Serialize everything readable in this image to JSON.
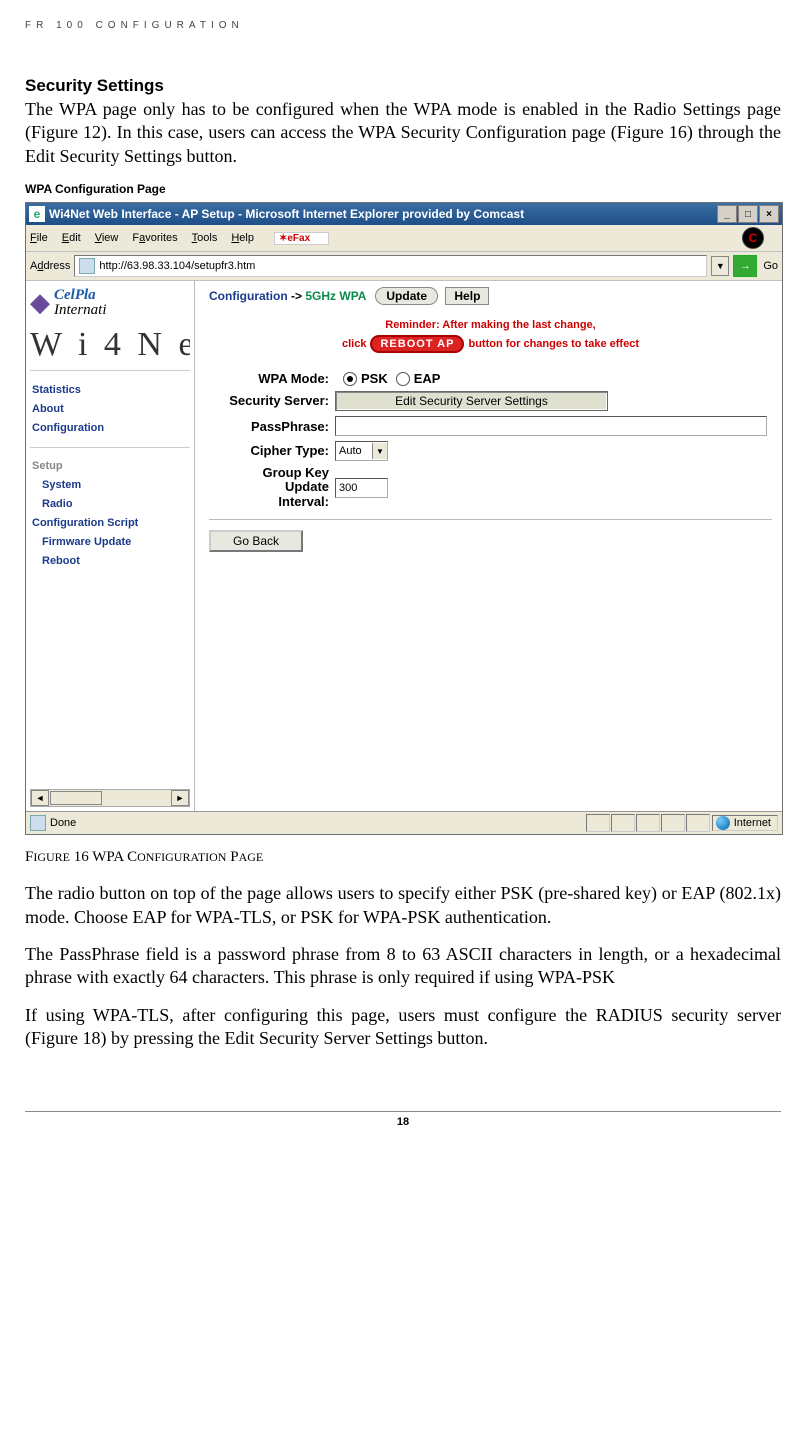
{
  "doc": {
    "running_header": "FR 100 CONFIGURATION",
    "section_title": "Security Settings",
    "p1": "The WPA page only has to be configured when the WPA mode is enabled in the Radio Settings page (Figure 12). In this case, users can access the WPA Security Configuration page (Figure 16) through the Edit Security Settings button.",
    "sub_heading": "WPA Configuration Page",
    "figure_caption": "Figure 16 WPA Configuration Page",
    "p2": "The radio button on top of the page allows users to specify either PSK (pre-shared key) or EAP (802.1x) mode. Choose EAP for WPA-TLS, or PSK for WPA-PSK authentication.",
    "p3": "The PassPhrase field is a password phrase from 8 to 63 ASCII characters in length, or a hexadecimal phrase with exactly 64 characters. This phrase is only required if using WPA-PSK",
    "p4": "If using WPA-TLS, after configuring this page, users must configure the RADIUS security server (Figure 18) by pressing the Edit Security Server Settings button.",
    "page_number": "18"
  },
  "browser": {
    "title": "Wi4Net Web Interface - AP Setup - Microsoft Internet Explorer provided by Comcast",
    "menus": {
      "file": "File",
      "edit": "Edit",
      "view": "View",
      "favorites": "Favorites",
      "tools": "Tools",
      "help": "Help",
      "efax": "eFax"
    },
    "address_label": "Address",
    "url": "http://63.98.33.104/setupfr3.htm",
    "go_label": "Go",
    "status_text": "Done",
    "zone_text": "Internet"
  },
  "page": {
    "logo_line1": "CelPla",
    "logo_line2": "Internati",
    "wi4net": "W i 4 N e",
    "nav": {
      "statistics": "Statistics",
      "about": "About",
      "configuration": "Configuration",
      "setup_header": "Setup",
      "system": "System",
      "radio": "Radio",
      "config_script": "Configuration Script",
      "firmware": "Firmware Update",
      "reboot": "Reboot"
    },
    "crumb": {
      "c1": "Configuration",
      "arrow": "->",
      "c3": "5GHz WPA"
    },
    "buttons": {
      "update": "Update",
      "help": "Help",
      "edit_security": "Edit Security Server Settings",
      "go_back": "Go Back",
      "reboot_ap": "REBOOT AP"
    },
    "reminder": {
      "line1": "Reminder: After making the last change,",
      "before": "click",
      "after": "button for changes to take effect"
    },
    "form": {
      "wpa_mode_label": "WPA Mode:",
      "psk": "PSK",
      "eap": "EAP",
      "security_server_label": "Security Server:",
      "passphrase_label": "PassPhrase:",
      "cipher_label": "Cipher Type:",
      "cipher_value": "Auto",
      "gk_label1": "Group Key",
      "gk_label2": "Update",
      "gk_label3": "Interval:",
      "gk_value": "300"
    }
  }
}
